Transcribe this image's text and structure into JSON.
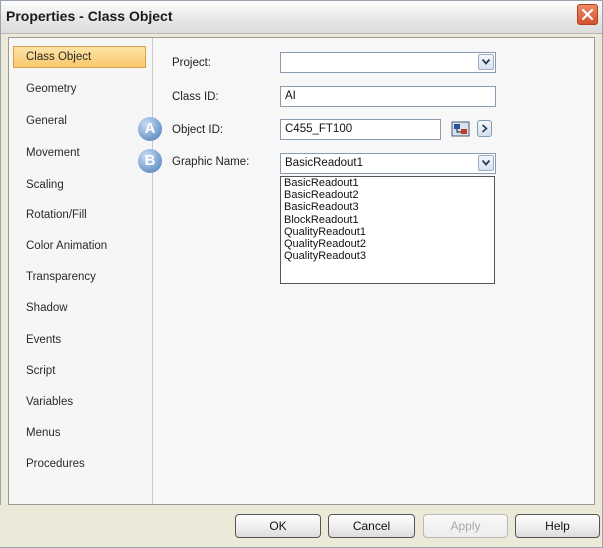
{
  "window": {
    "title": "Properties - Class Object"
  },
  "sidebar": {
    "items": [
      {
        "label": "Class Object",
        "active": true
      },
      {
        "label": "Geometry"
      },
      {
        "label": "General"
      },
      {
        "label": "Movement"
      },
      {
        "label": "Scaling"
      },
      {
        "label": "Rotation/Fill"
      },
      {
        "label": "Color Animation"
      },
      {
        "label": "Transparency"
      },
      {
        "label": "Shadow"
      },
      {
        "label": "Events"
      },
      {
        "label": "Script"
      },
      {
        "label": "Variables"
      },
      {
        "label": "Menus"
      },
      {
        "label": "Procedures"
      }
    ]
  },
  "form": {
    "project": {
      "label": "Project:",
      "value": ""
    },
    "class_id": {
      "label": "Class ID:",
      "value": "AI"
    },
    "object_id": {
      "label": "Object ID:",
      "value": "C455_FT100",
      "marker": "A"
    },
    "graphic_name": {
      "label": "Graphic Name:",
      "value": "BasicReadout1",
      "marker": "B"
    },
    "graphic_options": [
      "BasicReadout1",
      "BasicReadout2",
      "BasicReadout3",
      "BlockReadout1",
      "QualityReadout1",
      "QualityReadout2",
      "QualityReadout3"
    ]
  },
  "buttons": {
    "ok": "OK",
    "cancel": "Cancel",
    "apply": "Apply",
    "help": "Help"
  },
  "colors": {
    "active_item": "#f9c86c",
    "close_button": "#d2502c",
    "marker": "#6d98c9"
  },
  "icons": {
    "close": "close-icon",
    "dropdown": "chevron-down-icon",
    "browse": "object-browse-icon",
    "expand": "chevron-right-icon"
  }
}
